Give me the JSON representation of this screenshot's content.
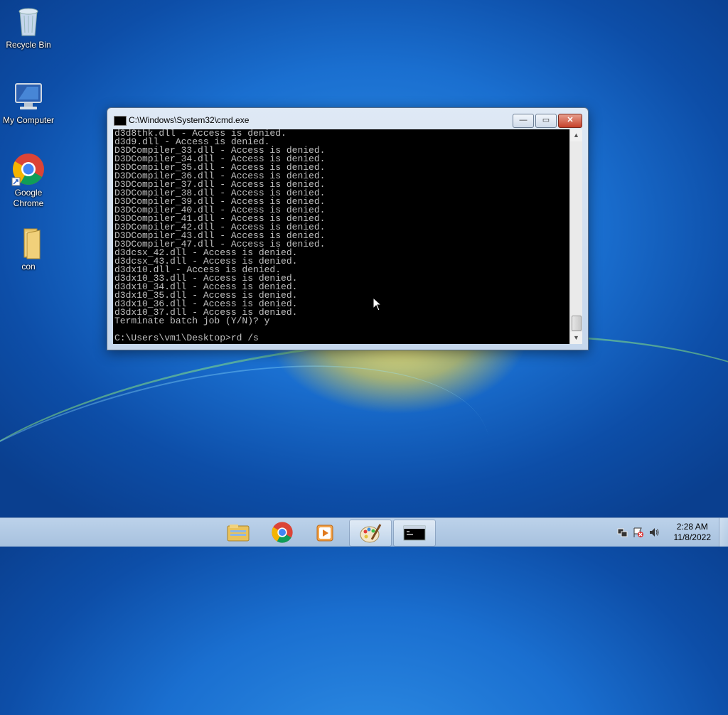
{
  "desktop": {
    "icons": [
      {
        "label": "Recycle Bin",
        "icon": "recycle-bin-icon"
      },
      {
        "label": "My Computer",
        "icon": "computer-icon"
      },
      {
        "label": "Google Chrome",
        "icon": "chrome-icon"
      },
      {
        "label": "con",
        "icon": "folder-icon"
      }
    ]
  },
  "window": {
    "title": "C:\\Windows\\System32\\cmd.exe",
    "buttons": {
      "minimize": "—",
      "maximize": "▭",
      "close": "✕"
    },
    "console_lines": [
      "d3d8thk.dll - Access is denied.",
      "d3d9.dll - Access is denied.",
      "D3DCompiler_33.dll - Access is denied.",
      "D3DCompiler_34.dll - Access is denied.",
      "D3DCompiler_35.dll - Access is denied.",
      "D3DCompiler_36.dll - Access is denied.",
      "D3DCompiler_37.dll - Access is denied.",
      "D3DCompiler_38.dll - Access is denied.",
      "D3DCompiler_39.dll - Access is denied.",
      "D3DCompiler_40.dll - Access is denied.",
      "D3DCompiler_41.dll - Access is denied.",
      "D3DCompiler_42.dll - Access is denied.",
      "D3DCompiler_43.dll - Access is denied.",
      "D3DCompiler_47.dll - Access is denied.",
      "d3dcsx_42.dll - Access is denied.",
      "d3dcsx_43.dll - Access is denied.",
      "d3dx10.dll - Access is denied.",
      "d3dx10_33.dll - Access is denied.",
      "d3dx10_34.dll - Access is denied.",
      "d3dx10_35.dll - Access is denied.",
      "d3dx10_36.dll - Access is denied.",
      "d3dx10_37.dll - Access is denied.",
      "Terminate batch job (Y/N)? y"
    ],
    "prompt": "C:\\Users\\vm1\\Desktop>rd /s"
  },
  "taskbar": {
    "items": [
      {
        "icon": "file-explorer-icon",
        "active": false
      },
      {
        "icon": "chrome-icon",
        "active": false
      },
      {
        "icon": "media-player-icon",
        "active": false
      },
      {
        "icon": "paint-icon",
        "active": true
      },
      {
        "icon": "cmd-icon",
        "active": true
      }
    ],
    "clock": {
      "time": "2:28 AM",
      "date": "11/8/2022"
    },
    "tray_icons": [
      "network-icon",
      "action-center-flag-icon",
      "volume-icon"
    ]
  }
}
